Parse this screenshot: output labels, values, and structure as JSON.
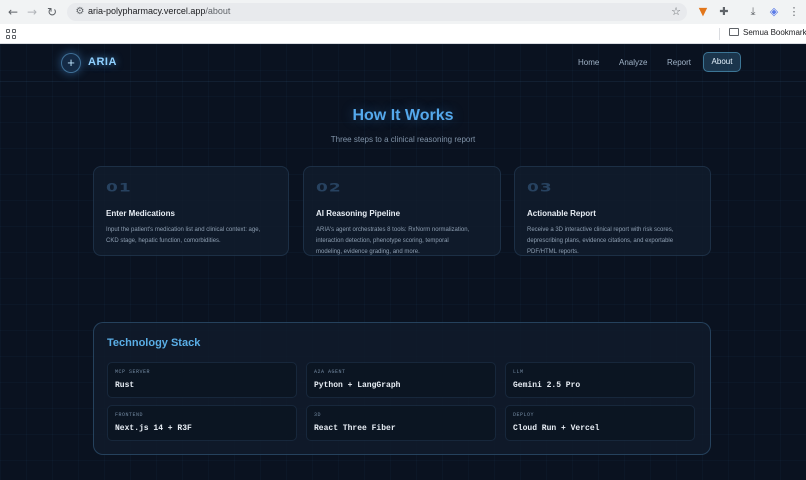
{
  "browser": {
    "url_host": "aria-polypharmacy.vercel.app",
    "url_path": "/about",
    "bookmark_folder": "Semua Bookmark",
    "icons": [
      "back-arrow-icon",
      "forward-arrow-icon",
      "reload-icon",
      "tune-icon",
      "star-icon",
      "metamask-fox-icon",
      "puzzle-extensions-icon",
      "download-icon",
      "profile-shield-icon",
      "kebab-menu-icon",
      "apps-grid-icon",
      "folder-icon"
    ]
  },
  "site": {
    "logo_symbol": "+",
    "logo_text": "ARIA",
    "nav": {
      "home": "Home",
      "analyze": "Analyze",
      "report": "Report",
      "about": "About"
    }
  },
  "hero": {
    "title": "How It Works",
    "subtitle": "Three steps to a clinical reasoning report"
  },
  "steps": [
    {
      "number": "01",
      "title": "Enter Medications",
      "desc_line1": "Input the patient's medication list and clinical context: age,",
      "desc_line2": "CKD stage, hepatic function, comorbidities.",
      "desc_line3": ""
    },
    {
      "number": "02",
      "title": "AI Reasoning Pipeline",
      "desc_line1": "ARIA's agent orchestrates 8 tools: RxNorm normalization,",
      "desc_line2": "interaction detection, phenotype scoring, temporal",
      "desc_line3": "modeling, evidence grading, and more."
    },
    {
      "number": "03",
      "title": "Actionable Report",
      "desc_line1": "Receive a 3D interactive clinical report with risk scores,",
      "desc_line2": "deprescribing plans, evidence citations, and exportable",
      "desc_line3": "PDF/HTML reports."
    }
  ],
  "tech": {
    "title": "Technology Stack",
    "items": [
      {
        "label": "MCP SERVER",
        "value": "Rust"
      },
      {
        "label": "A2A AGENT",
        "value": "Python + LangGraph"
      },
      {
        "label": "LLM",
        "value": "Gemini 2.5 Pro"
      },
      {
        "label": "FRONTEND",
        "value": "Next.js 14 + R3F"
      },
      {
        "label": "3D",
        "value": "React Three Fiber"
      },
      {
        "label": "DEPLOY",
        "value": "Cloud Run + Vercel"
      }
    ]
  },
  "colors": {
    "background": "#0a1220",
    "accent": "#55a9ec",
    "card": "#121e2e",
    "text": "#e8eef5"
  }
}
